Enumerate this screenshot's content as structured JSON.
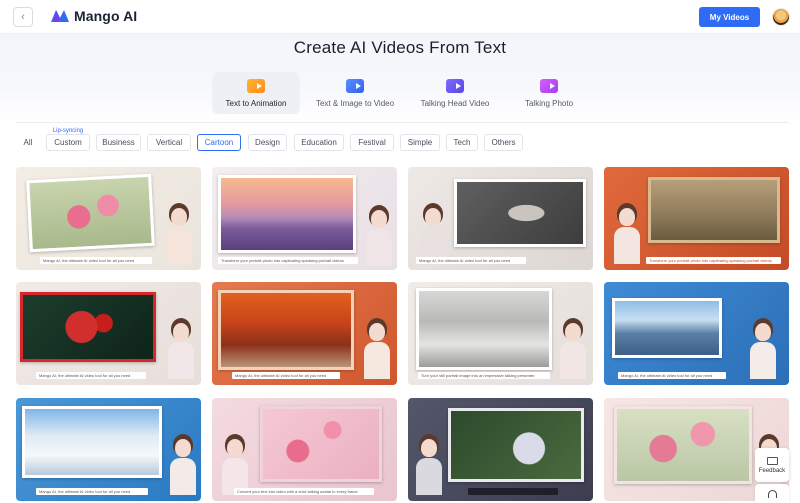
{
  "header": {
    "back_icon": "chevron-left-icon",
    "logo_text": "Mango AI",
    "my_videos_label": "My Videos",
    "brand_color": "#2f6cf6"
  },
  "page": {
    "title": "Create AI Videos From Text"
  },
  "category_tabs": [
    {
      "label": "Text to Animation",
      "icon": "animation-icon",
      "active": true
    },
    {
      "label": "Text & Image to Video",
      "icon": "image-video-icon",
      "active": false
    },
    {
      "label": "Talking Head Video",
      "icon": "talking-head-icon",
      "active": false
    },
    {
      "label": "Talking Photo",
      "icon": "talking-photo-icon",
      "active": false
    }
  ],
  "filters": [
    {
      "label": "All"
    },
    {
      "label": "Custom",
      "badge": "Lip-syncing"
    },
    {
      "label": "Business"
    },
    {
      "label": "Vertical"
    },
    {
      "label": "Cartoon",
      "active": true
    },
    {
      "label": "Design"
    },
    {
      "label": "Education"
    },
    {
      "label": "Festival"
    },
    {
      "label": "Simple"
    },
    {
      "label": "Tech"
    },
    {
      "label": "Others"
    }
  ],
  "templates": [
    {
      "caption": "Mango AI, the ultimate AI video tool for all you need"
    },
    {
      "caption": "Transform your portrait photo into captivating speaking portrait videos"
    },
    {
      "caption": "Mango AI, the ultimate AI video tool for all you need"
    },
    {
      "caption": "Transform your portrait photo into captivating speaking portrait videos"
    },
    {
      "caption": "Mango AI, the ultimate AI video tool for all you need"
    },
    {
      "caption": "Mango AI, the ultimate AI video tool for all you need"
    },
    {
      "caption": "Turn your still portrait image into an impressive talking presenter."
    },
    {
      "caption": "Mango AI, the ultimate AI video tool for all you need"
    },
    {
      "caption": "Mango AI, the ultimate AI video tool for all you need"
    },
    {
      "caption": "Convert your text into video with a vivid talking avatar in every frame."
    },
    {
      "caption": ""
    },
    {
      "caption": ""
    }
  ],
  "feedback": {
    "label": "Feedback",
    "icon": "mail-icon",
    "support_icon": "headset-icon"
  }
}
